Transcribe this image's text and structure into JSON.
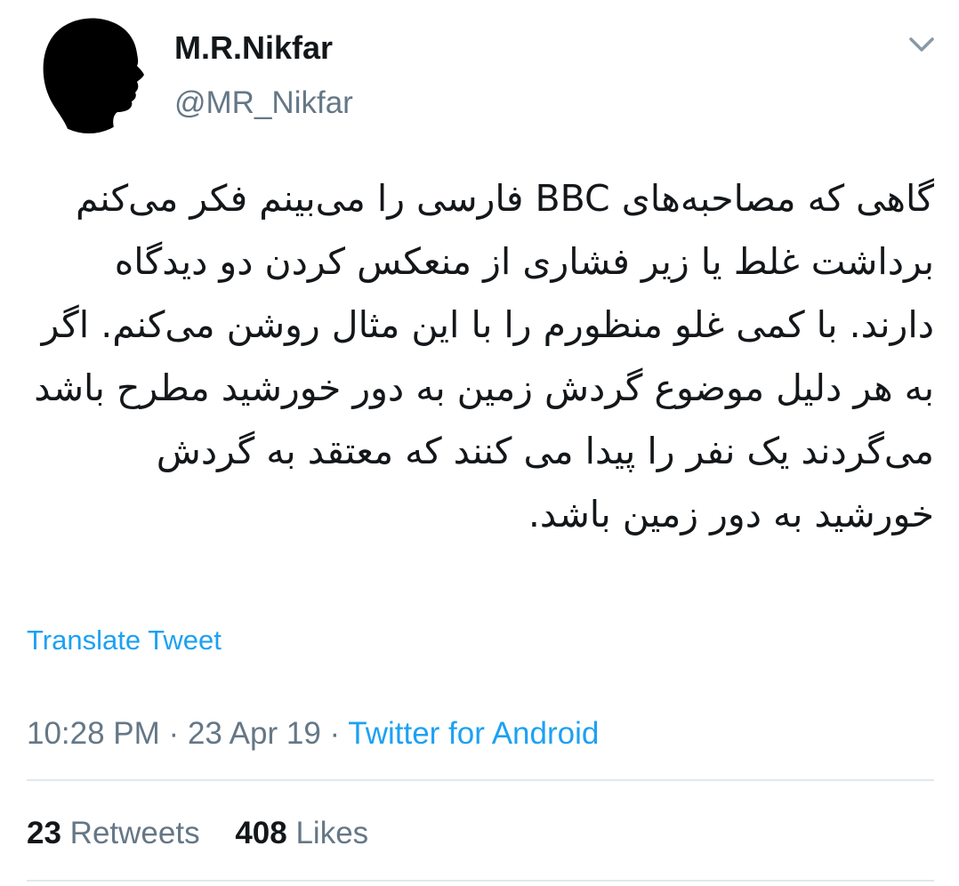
{
  "colors": {
    "text": "#14171a",
    "secondary": "#657786",
    "link": "#1da1f2",
    "divider": "#e1e8ed"
  },
  "tweet": {
    "author": {
      "display_name": "M.R.Nikfar",
      "handle": "@MR_Nikfar",
      "avatar_icon": "silhouette-avatar-icon"
    },
    "menu_icon": "chevron-down-icon",
    "text": "گاهی که مصاحبه‌های BBC فارسی را می‌بینم فکر می‌کنم برداشت غلط یا زیر فشاری از منعکس کردن دو دیدگاه دارند. با کمی غلو منظورم را با این مثال روشن می‌کنم. اگر به هر دلیل موضوع گردش زمین به دور خورشید مطرح باشد می‌گردند یک نفر را پیدا می کنند که معتقد به گردش خورشید به دور زمین باشد.",
    "translate_label": "Translate Tweet",
    "time": "10:28 PM",
    "separator": "·",
    "date": "23 Apr 19",
    "source": "Twitter for Android",
    "stats": {
      "retweets_count": "23",
      "retweets_label": "Retweets",
      "likes_count": "408",
      "likes_label": "Likes"
    }
  }
}
